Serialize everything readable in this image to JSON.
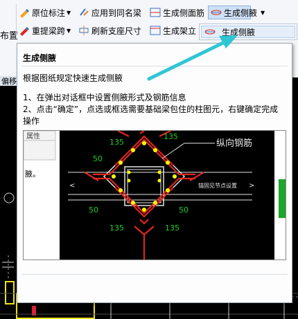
{
  "ribbon": {
    "row1": {
      "origin_mark": "原位标注",
      "apply_same_beam": "应用到同名梁",
      "gen_side_rebar": "生成侧面筋",
      "gen_haunch": "生成侧腋"
    },
    "row2": {
      "relift_span": "重提梁跨",
      "refresh_support": "刷新支座尺寸",
      "gen_erection": "生成架立"
    },
    "left_partial": "布置"
  },
  "dropdown": {
    "items": [
      "生成侧腋"
    ]
  },
  "tab_strip": {
    "label": "偏移"
  },
  "tooltip": {
    "title": "生成侧腋",
    "description": "根据图纸规定快速生成侧腋",
    "step1": "1、在弹出对话框中设置侧腋形式及钢筋信息",
    "step2": "2、点击“确定”，点选或框选需要基础梁包住的柱图元，右键确定完成操作",
    "image": {
      "left_panel_text": "腋。",
      "left_panel_header": "属性",
      "label_longitudinal": "纵向钢筋",
      "label_anchor": "锚固见节点设置",
      "dim_135": "135",
      "dim_50": "50"
    }
  },
  "colors": {
    "arrow": "#2ec6d4",
    "rebar": "#e0261e",
    "dots": "#ffff00",
    "dims": "#1fd11f"
  }
}
